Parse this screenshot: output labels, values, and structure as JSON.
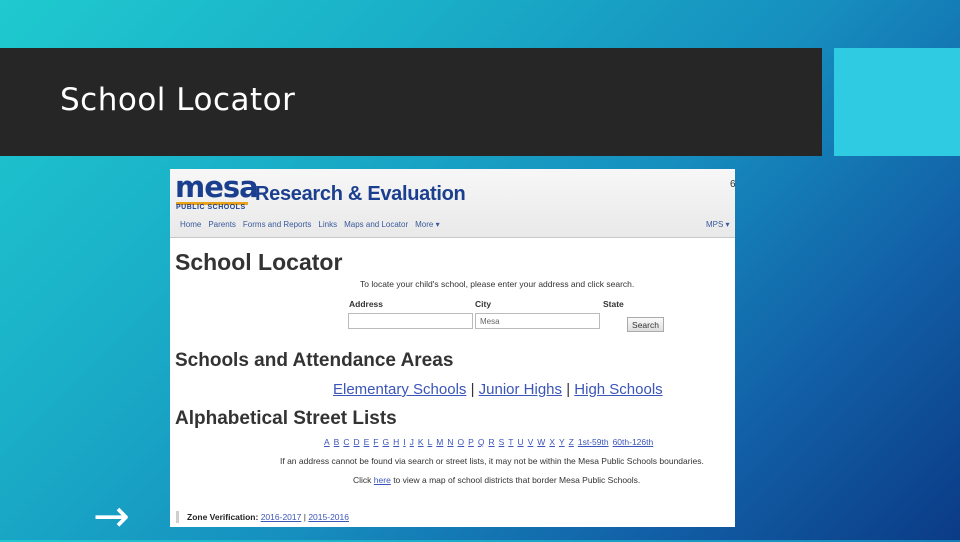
{
  "slide": {
    "title": "School Locator",
    "arrow_glyph": "→"
  },
  "colors": {
    "title_bar": "#262626",
    "accent_block": "#2fcbe3",
    "link": "#3b55b8",
    "brand_blue": "#1b3f8f",
    "brand_orange": "#e8a21c"
  },
  "site": {
    "logo_text": "mesa",
    "logo_subtext": "PUBLIC SCHOOLS",
    "department": "Research & Evaluation",
    "header_corner": "6",
    "nav": [
      "Home",
      "Parents",
      "Forms and Reports",
      "Links",
      "Maps and Locator",
      "More ▾"
    ],
    "nav_right": "MPS ▾"
  },
  "locator": {
    "heading": "School Locator",
    "instructions": "To locate your child's school, please enter your address and click search.",
    "address_label": "Address",
    "city_label": "City",
    "city_value": "Mesa",
    "state_label": "State",
    "search_button": "Search"
  },
  "attendance": {
    "heading": "Schools and Attendance Areas",
    "link_elementary": "Elementary Schools",
    "link_junior": "Junior Highs",
    "link_high": "High Schools",
    "separator": "|"
  },
  "streets": {
    "heading": "Alphabetical Street Lists",
    "letters": [
      "A",
      "B",
      "C",
      "D",
      "E",
      "F",
      "G",
      "H",
      "I",
      "J",
      "K",
      "L",
      "M",
      "N",
      "O",
      "P",
      "Q",
      "R",
      "S",
      "T",
      "U",
      "V",
      "W",
      "X",
      "Y",
      "Z",
      "1st-59th",
      "60th-126th"
    ],
    "note_not_found": "If an address cannot be found via search or street lists, it may not be within the Mesa Public Schools boundaries.",
    "note_click": "Click",
    "note_here": "here",
    "note_rest": "to view a map of school districts that border Mesa Public Schools."
  },
  "zone": {
    "label": "Zone Verification:",
    "link_2016": "2016-2017",
    "separator": "|",
    "link_2015": "2015-2016"
  }
}
